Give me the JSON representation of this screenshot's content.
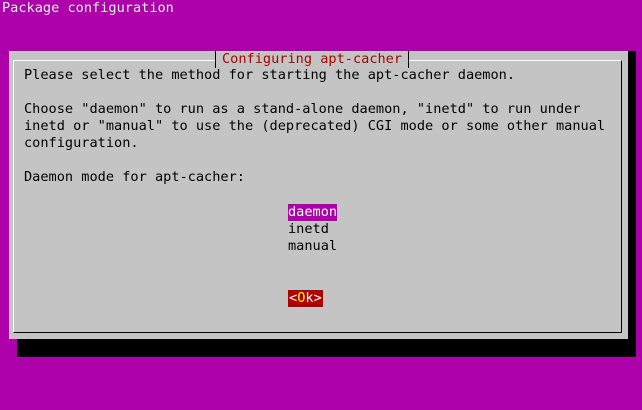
{
  "terminal": {
    "backtitle": "Package configuration"
  },
  "dialog": {
    "title": "Configuring apt-cacher",
    "lines": [
      "Please select the method for starting the apt-cacher daemon.",
      "",
      "Choose \"daemon\" to run as a stand-alone daemon, \"inetd\" to run under",
      "inetd or \"manual\" to use the (deprecated) CGI mode or some other manual",
      "configuration.",
      "",
      "Daemon mode for apt-cacher:"
    ],
    "options": [
      "daemon",
      "inetd",
      "manual"
    ],
    "selected_option": "daemon",
    "ok_button": {
      "left": "<",
      "label_first": "O",
      "label_rest": "k",
      "right": ">"
    }
  },
  "colors": {
    "background": "#ad00aa",
    "dialog": "#c4c4c4",
    "title_text": "#b00000",
    "selection": "#ad00aa",
    "button_bg": "#b00000",
    "button_hotkey": "#ffff00"
  }
}
